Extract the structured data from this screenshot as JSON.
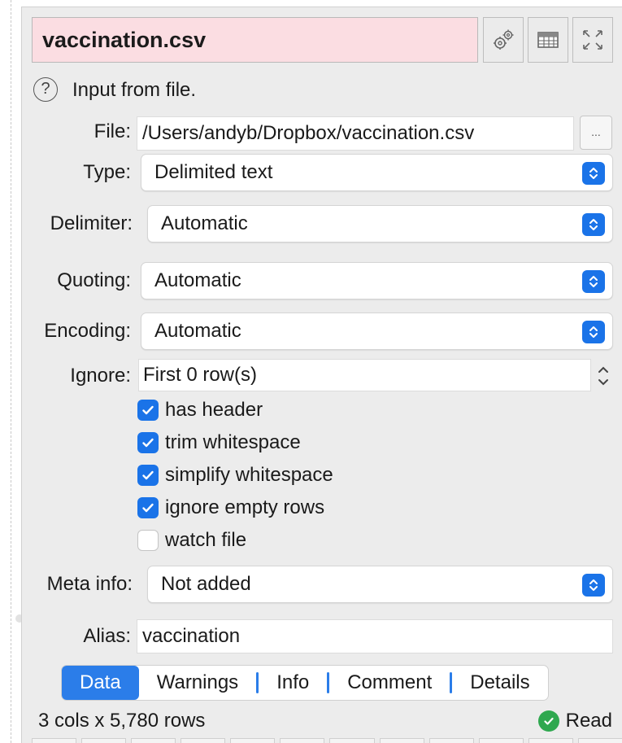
{
  "header": {
    "title": "vaccination.csv",
    "title_bg": "#fbdde2",
    "buttons": [
      "settings-gears-icon",
      "table-view-icon",
      "expand-icon"
    ]
  },
  "info": {
    "help_glyph": "?",
    "text": "Input from file."
  },
  "file": {
    "label": "File:",
    "value": "/Users/andyb/Dropbox/vaccination.csv",
    "browse": "..."
  },
  "type": {
    "label": "Type:",
    "value": "Delimited text"
  },
  "delimiter": {
    "label": "Delimiter:",
    "value": "Automatic"
  },
  "quoting": {
    "label": "Quoting:",
    "value": "Automatic"
  },
  "encoding": {
    "label": "Encoding:",
    "value": "Automatic"
  },
  "ignore": {
    "label": "Ignore:",
    "value": "First 0 row(s)"
  },
  "options": [
    {
      "label": "has header",
      "checked": true
    },
    {
      "label": "trim whitespace",
      "checked": true
    },
    {
      "label": "simplify whitespace",
      "checked": true
    },
    {
      "label": "ignore empty rows",
      "checked": true
    },
    {
      "label": "watch file",
      "checked": false
    }
  ],
  "meta": {
    "label": "Meta info:",
    "value": "Not added"
  },
  "alias": {
    "label": "Alias:",
    "value": "vaccination"
  },
  "tabs": [
    {
      "label": "Data",
      "active": true
    },
    {
      "label": "Warnings",
      "active": false
    },
    {
      "label": "Info",
      "active": false
    },
    {
      "label": "Comment",
      "active": false
    },
    {
      "label": "Details",
      "active": false
    }
  ],
  "status": {
    "dimensions": "3 cols x 5,780 rows",
    "state": "Read"
  },
  "colors": {
    "accent": "#1a73e8",
    "active_tab": "#2b7de9",
    "ok": "#2fa84f",
    "panel_bg": "#ececec"
  }
}
